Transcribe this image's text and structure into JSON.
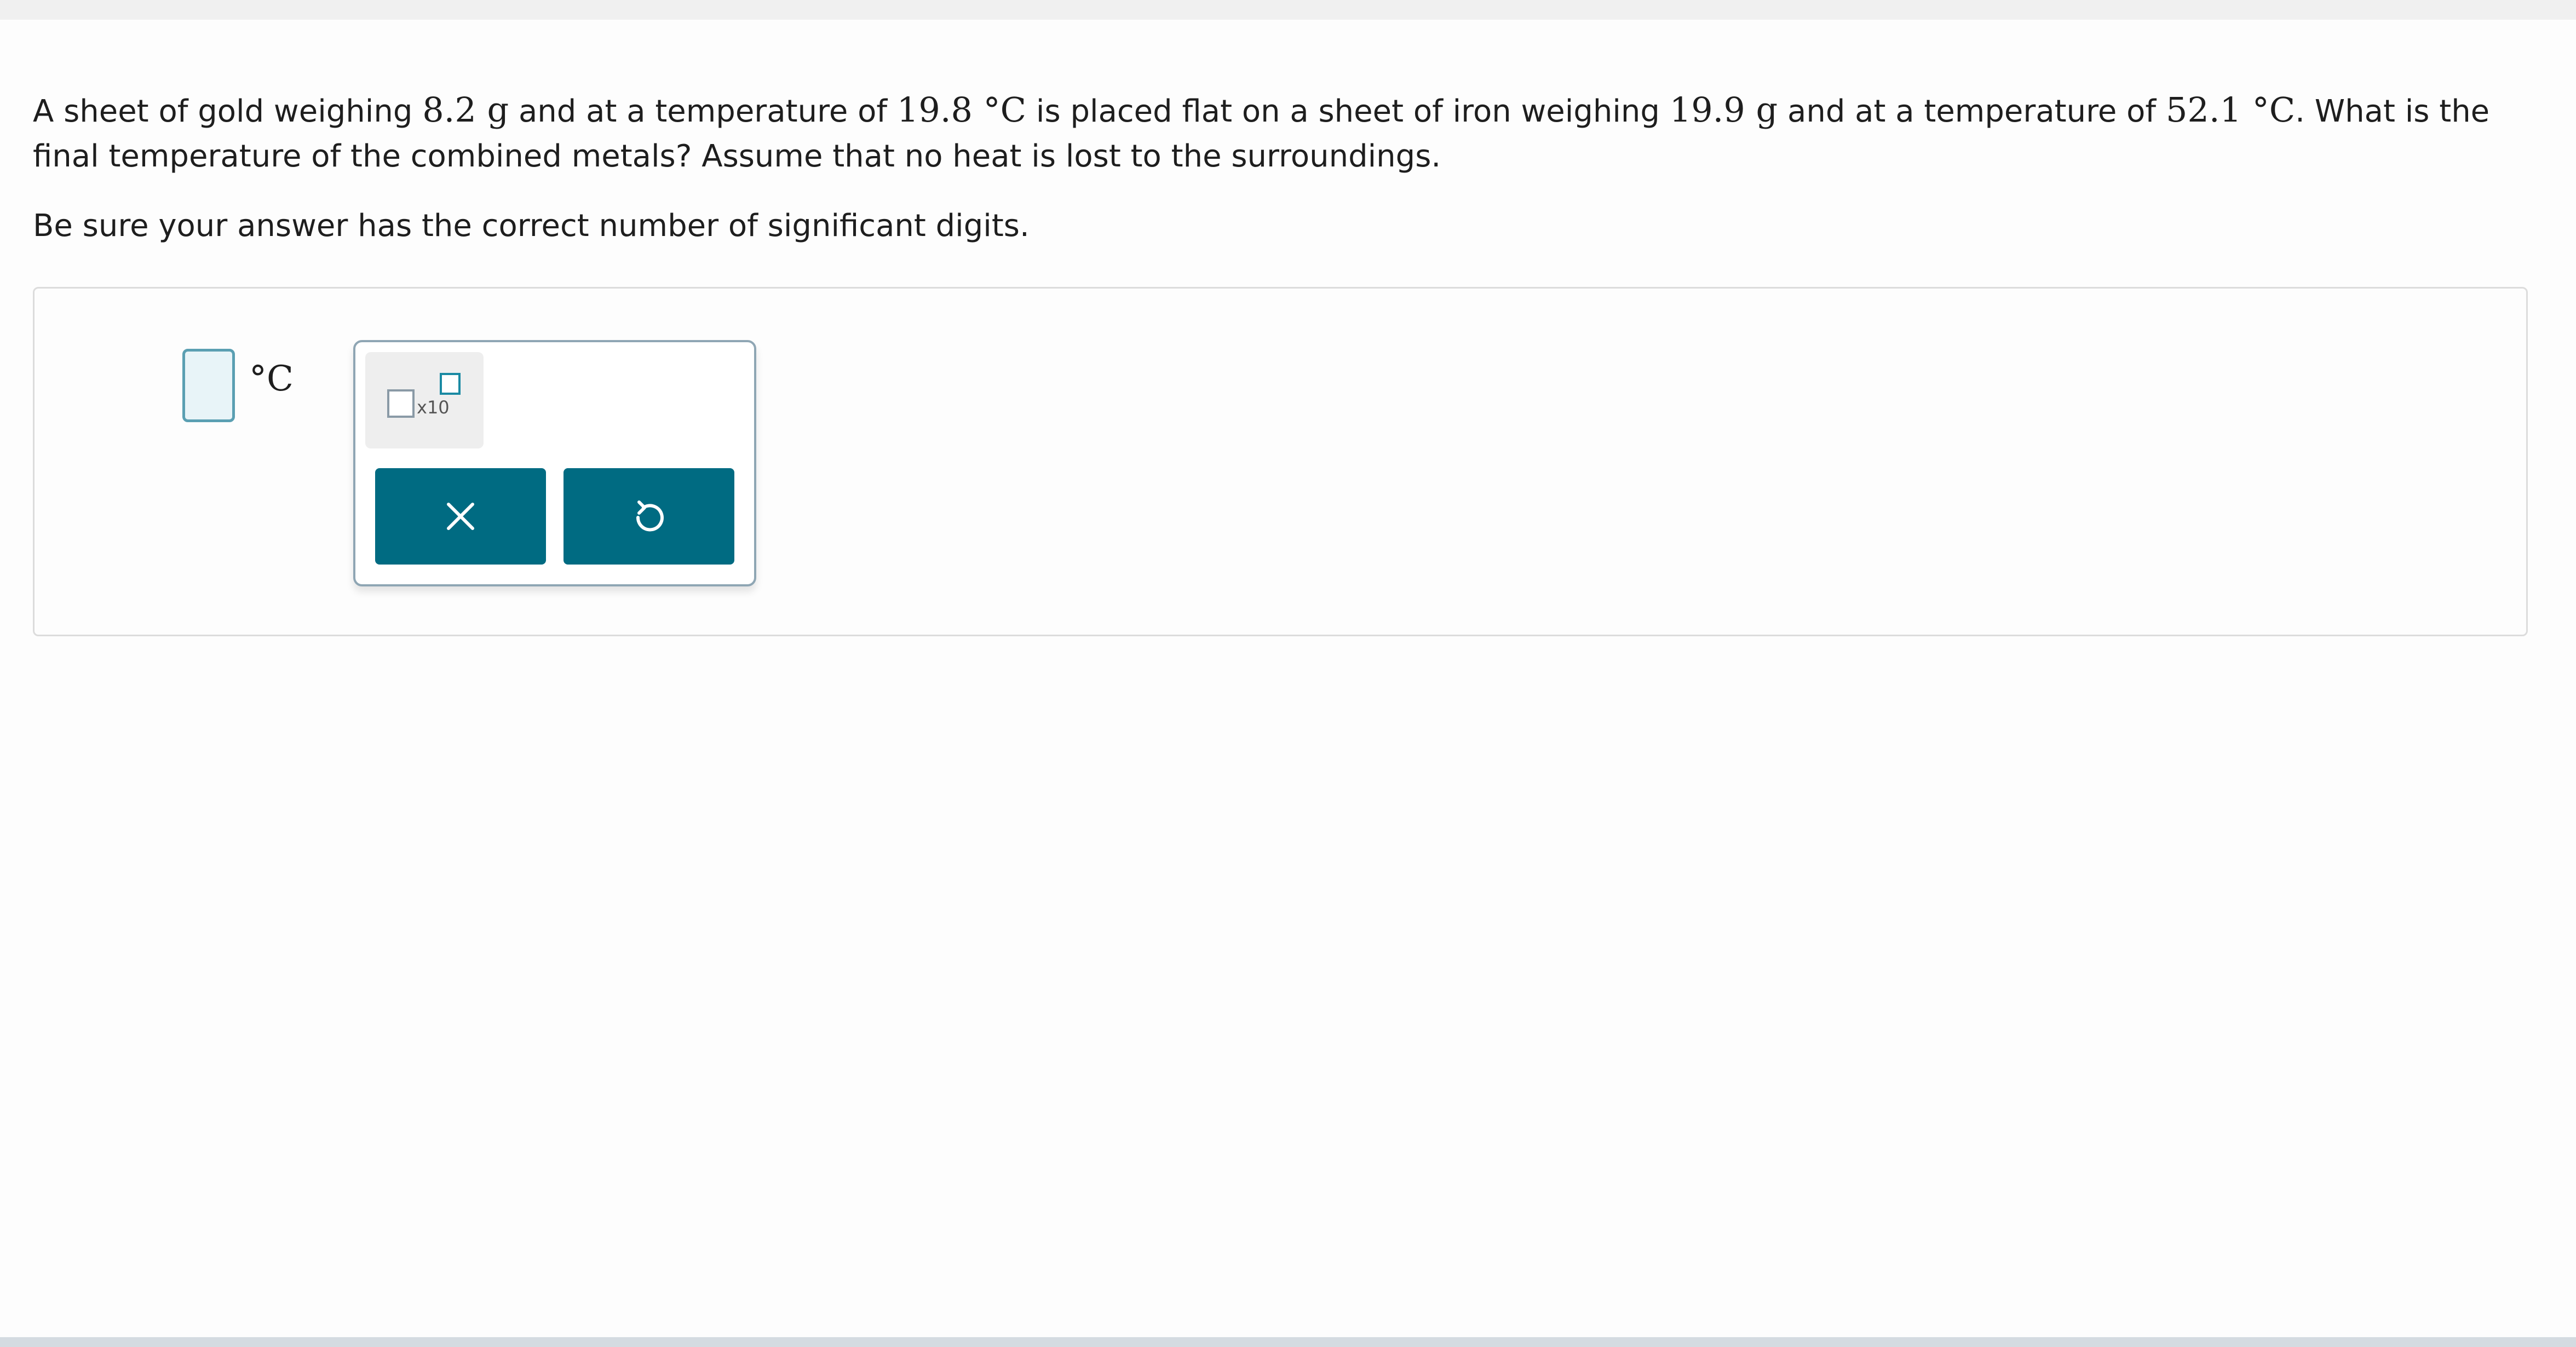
{
  "question": {
    "p1": "A sheet of gold weighing ",
    "m1": "8.2 g",
    "p2": " and at a temperature of ",
    "m2": "19.8 °C",
    "p3": " is placed flat on a sheet of iron weighing ",
    "m3": "19.9 g",
    "p4": " and at a temperature of ",
    "m4": "52.1 °C",
    "p5": ". What is the final temperature of the combined metals? Assume that no heat is lost to the surroundings."
  },
  "instructions": "Be sure your answer has the correct number of significant digits.",
  "answer": {
    "value": "",
    "unit": "°C"
  },
  "palette": {
    "sci_notation_label": "x10",
    "icons": {
      "scientific_notation": "scientific-notation-icon",
      "clear": "close-icon",
      "reset": "undo-icon"
    }
  },
  "colors": {
    "button_bg": "#006b82",
    "input_border": "#5a9fb2",
    "input_bg": "#e8f4f8",
    "exponent_box": "#1a8aa3"
  }
}
